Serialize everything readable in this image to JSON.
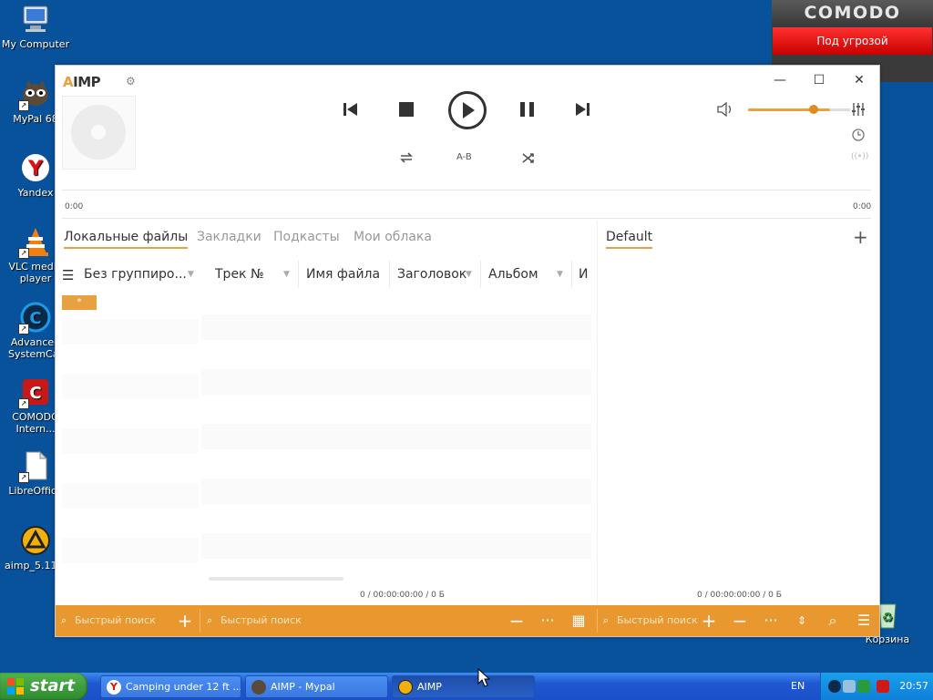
{
  "desktop": {
    "icons": [
      {
        "name": "My Computer",
        "label": "My Computer"
      },
      {
        "name": "MyPal",
        "label": "MyPal 68"
      },
      {
        "name": "Yandex",
        "label": "Yandex"
      },
      {
        "name": "VLC",
        "label": "VLC media\nplayer"
      },
      {
        "name": "Advanced SystemCare",
        "label": "Advanced\nSystemCar"
      },
      {
        "name": "COMODO Internet",
        "label": "COMODO\nIntern..."
      },
      {
        "name": "LibreOffice",
        "label": "LibreOffice"
      },
      {
        "name": "aimp installer",
        "label": "aimp_5.11.2"
      },
      {
        "name": "Recycle Bin",
        "label": "Корзина"
      }
    ]
  },
  "comodo": {
    "brand": "COMODO",
    "status": "Под угрозой"
  },
  "aimp": {
    "logo_prefix": "A",
    "logo_rest": "IMP",
    "window_controls": {
      "minimize": "—",
      "maximize": "☐",
      "close": "✕"
    },
    "ab_label": "A-B",
    "time_current": "0:00",
    "time_total": "0:00",
    "tabs": [
      "Локальные файлы",
      "Закладки",
      "Подкасты",
      "Мои облака"
    ],
    "playlist_tab": "Default",
    "add_playlist": "+",
    "columns": {
      "group": "Без группиро...",
      "track": "Трек №",
      "filename": "Имя файла",
      "title": "Заголовок",
      "album": "Альбом",
      "artist": "И"
    },
    "group_tag": "*",
    "library_status": "0 / 00:00:00:00 / 0 Б",
    "playlist_status": "0 / 00:00:00:00 / 0 Б",
    "search_placeholder_1": "Быстрый поиск",
    "search_placeholder_2": "Быстрый поиск",
    "search_placeholder_3": "Быстрый поиск",
    "volume_level": 0.79,
    "accent": "#e8982f"
  },
  "taskbar": {
    "start": "start",
    "tasks": [
      {
        "label": "Camping under 12 ft ...",
        "icon": "yandex-icon"
      },
      {
        "label": "AIMP - Mypal",
        "icon": "mypal-icon"
      },
      {
        "label": "AIMP",
        "icon": "aimp-icon"
      }
    ],
    "lang": "EN",
    "clock": "20:57"
  }
}
